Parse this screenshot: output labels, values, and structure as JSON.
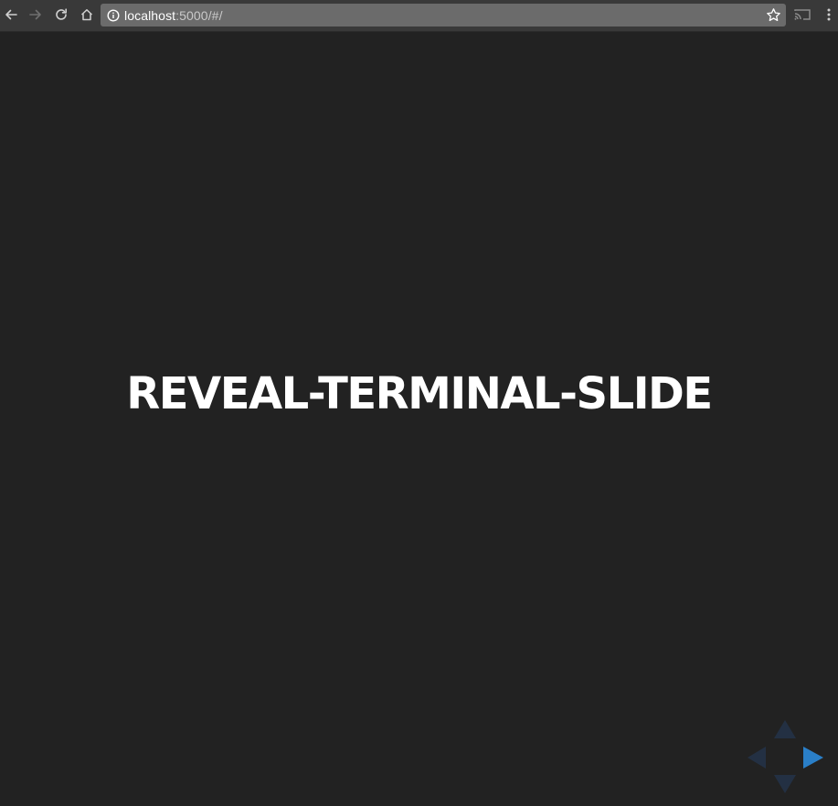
{
  "browser": {
    "url_host": "localhost",
    "url_path": ":5000/#/",
    "icons": {
      "back": "arrow-left-icon",
      "forward": "arrow-right-icon",
      "reload": "reload-icon",
      "home": "home-icon",
      "info": "info-icon",
      "bookmark": "star-icon",
      "cast": "cast-icon",
      "menu": "kebab-menu-icon"
    }
  },
  "slide": {
    "title": "REVEAL-TERMINAL-SLIDE",
    "background": "#222222",
    "text_color": "#ffffff"
  },
  "controls": {
    "accent": "#2a76dd",
    "active": [
      "right"
    ],
    "disabled": [
      "up",
      "left",
      "down"
    ]
  }
}
